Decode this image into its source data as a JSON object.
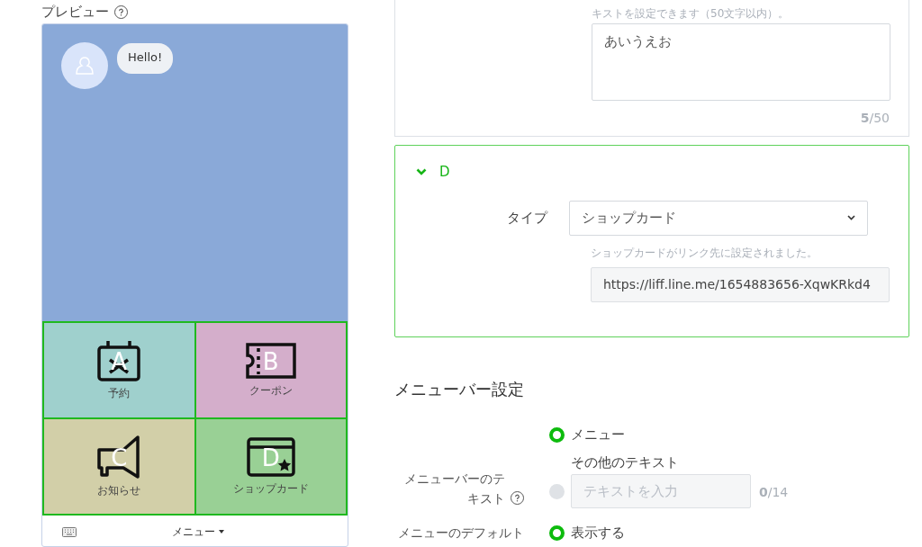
{
  "preview": {
    "title": "プレビュー",
    "bubble": "Hello!",
    "tiles": [
      {
        "letter": "A",
        "label": "予約",
        "kind": "calendar",
        "color": "#9fd0cd"
      },
      {
        "letter": "B",
        "label": "クーポン",
        "kind": "ticket",
        "color": "#d4aecb"
      },
      {
        "letter": "C",
        "label": "お知らせ",
        "kind": "megaphone",
        "color": "#d2cfa8"
      },
      {
        "letter": "D",
        "label": "ショップカード",
        "kind": "card",
        "color": "#99d095"
      }
    ],
    "menu_label": "メニュー"
  },
  "text_section": {
    "hint": "キストを設定できます（50文字以内）。",
    "value": "あいうえお",
    "count": "5",
    "max": "/50"
  },
  "action": {
    "title": "D",
    "expanded": true,
    "type_label": "タイプ",
    "type_value": "ショップカード",
    "note": "ショップカードがリンク先に設定されました。",
    "url": "https://liff.line.me/1654883656-XqwKRkd4"
  },
  "menubar": {
    "heading": "メニューバー設定",
    "text_label": "メニューバーのテキスト",
    "options": [
      {
        "kind": "plain",
        "label": "メニュー",
        "selected": true
      },
      {
        "kind": "custom",
        "label": "その他のテキスト",
        "selected": false,
        "placeholder": "テキストを入力",
        "count": "0",
        "max": "/14"
      }
    ],
    "default_label": "メニューのデフォルト",
    "default_options": [
      {
        "label": "表示する",
        "selected": true
      }
    ]
  }
}
